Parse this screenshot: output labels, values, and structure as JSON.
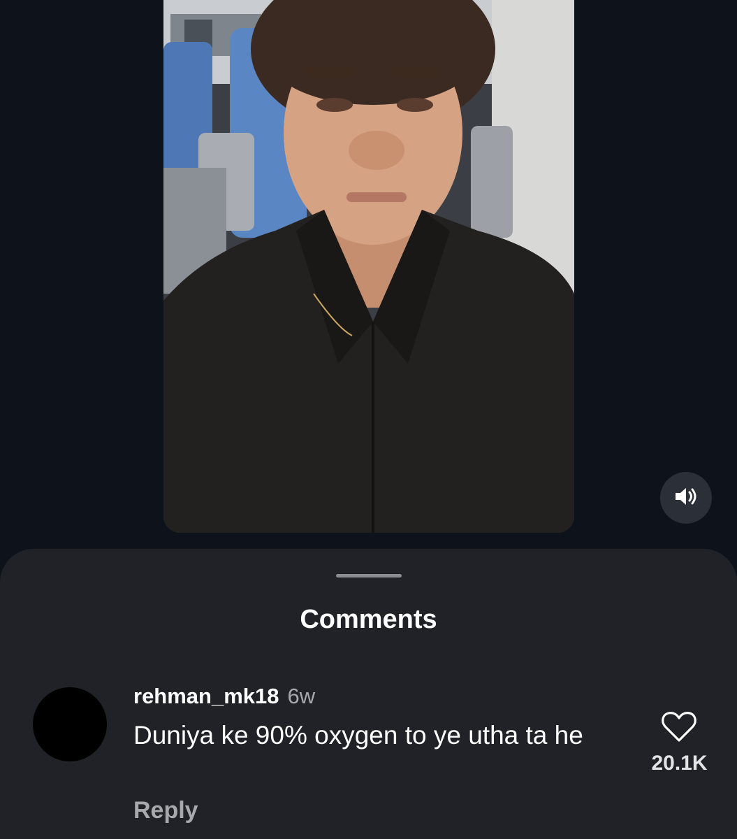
{
  "video": {
    "subject": "selfie-video-person-on-train"
  },
  "controls": {
    "sound_icon": "speaker-volume-icon"
  },
  "comments_sheet": {
    "title": "Comments",
    "comments": [
      {
        "username": "rehman_mk18",
        "age": "6w",
        "text": "Duniya ke 90% oxygen to ye utha ta he",
        "likes": "20.1K",
        "reply_label": "Reply",
        "like_icon": "heart-outline-icon"
      }
    ]
  },
  "colors": {
    "background": "#0e121a",
    "sheet": "#202227",
    "text_primary": "#ffffff",
    "text_secondary": "#a7a9ad"
  }
}
